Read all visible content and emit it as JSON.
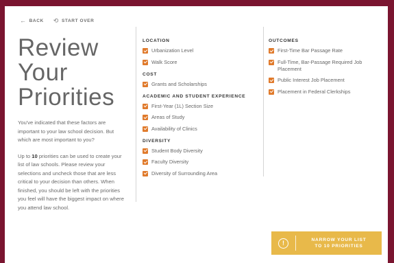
{
  "nav": {
    "back_label": "BACK",
    "start_over_label": "START OVER"
  },
  "title": "Review\nYour\nPriorities",
  "intro": {
    "p1": "You've indicated that these factors are important to your law school decision. But which are most important to you?",
    "p2_prefix": "Up to ",
    "p2_count": "10",
    "p2_suffix": " priorities can be used to create your list of law schools. Please review your selections and uncheck those that are less critical to your decision than others. When finished, you should be left with the priorities you feel will have the biggest impact on where you attend law school."
  },
  "columns": [
    {
      "sections": [
        {
          "heading": "LOCATION",
          "items": [
            "Urbanization Level",
            "Walk Score"
          ]
        },
        {
          "heading": "COST",
          "items": [
            "Grants and Scholarships"
          ]
        },
        {
          "heading": "ACADEMIC AND STUDENT EXPERIENCE",
          "items": [
            "First-Year (1L) Section Size",
            "Areas of Study",
            "Availability of Clinics"
          ]
        },
        {
          "heading": "DIVERSITY",
          "items": [
            "Student Body Diversity",
            "Faculty Diversity",
            "Diversity of Surrounding Area"
          ]
        }
      ]
    },
    {
      "sections": [
        {
          "heading": "OUTCOMES",
          "items": [
            "First-Time Bar Passage Rate",
            "Full-Time, Bar-Passage Required Job Placement",
            "Public Interest Job Placement",
            "Placement in Federal Clerkships"
          ]
        }
      ]
    }
  ],
  "checkbox_color": "#e07a2b",
  "cta": {
    "icon": "!",
    "label": "NARROW YOUR LIST\nTO 10 PRIORITIES",
    "color": "#e8b94a"
  },
  "icons": {
    "back": "arrow-left-icon",
    "start_over": "undo-icon",
    "cta": "alert-circle-icon"
  }
}
